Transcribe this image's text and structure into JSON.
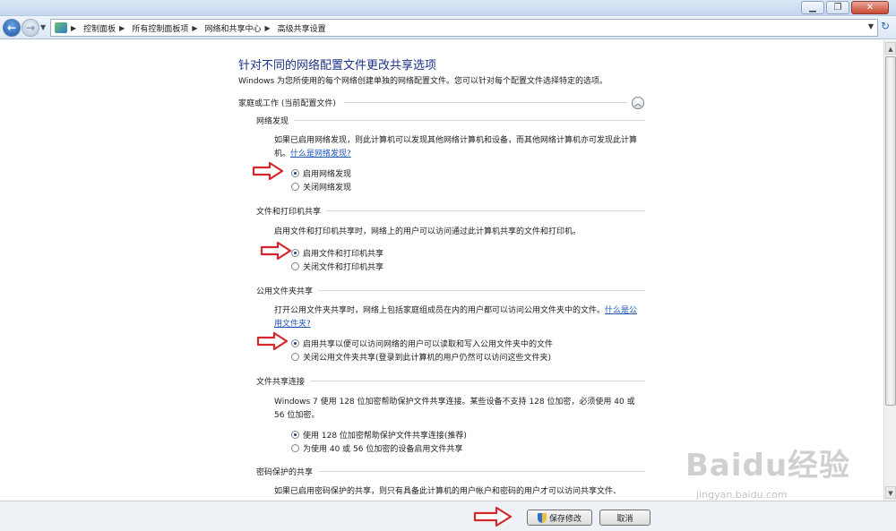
{
  "breadcrumbs": [
    "控制面板",
    "所有控制面板项",
    "网络和共享中心",
    "高级共享设置"
  ],
  "page": {
    "title": "针对不同的网络配置文件更改共享选项",
    "intro": "Windows 为您所使用的每个网络创建单独的网络配置文件。您可以针对每个配置文件选择特定的选项。",
    "profile_header": "家庭或工作 (当前配置文件)"
  },
  "sections": {
    "network_discovery": {
      "title": "网络发现",
      "desc": "如果已启用网络发现，则此计算机可以发现其他网络计算机和设备，而其他网络计算机亦可发现此计算机。",
      "link": "什么是网络发现?",
      "opt_on": "启用网络发现",
      "opt_off": "关闭网络发现"
    },
    "file_printer": {
      "title": "文件和打印机共享",
      "desc": "启用文件和打印机共享时，网络上的用户可以访问通过此计算机共享的文件和打印机。",
      "opt_on": "启用文件和打印机共享",
      "opt_off": "关闭文件和打印机共享"
    },
    "public_folder": {
      "title": "公用文件夹共享",
      "desc": "打开公用文件夹共享时，网络上包括家庭组成员在内的用户都可以访问公用文件夹中的文件。",
      "link": "什么是公用文件夹?",
      "opt_on": "启用共享以便可以访问网络的用户可以读取和写入公用文件夹中的文件",
      "opt_off": "关闭公用文件夹共享(登录到此计算机的用户仍然可以访问这些文件夹)"
    },
    "file_sharing": {
      "title": "文件共享连接",
      "desc": "Windows 7 使用 128 位加密帮助保护文件共享连接。某些设备不支持 128 位加密，必须使用 40 或 56 位加密。",
      "opt_128": "使用 128 位加密帮助保护文件共享连接(推荐)",
      "opt_40": "为使用 40 或 56 位加密的设备启用文件共享"
    },
    "password": {
      "title": "密码保护的共享",
      "desc": "如果已启用密码保护的共享，则只有具备此计算机的用户帐户和密码的用户才可以访问共享文件、"
    }
  },
  "footer": {
    "save": "保存修改",
    "cancel": "取消"
  },
  "watermark": {
    "logo": "Baidu经验",
    "url": "jingyan.baidu.com"
  },
  "colors": {
    "title": "#1e3287",
    "link": "#1a55b8",
    "arrow": "#d3272b"
  }
}
